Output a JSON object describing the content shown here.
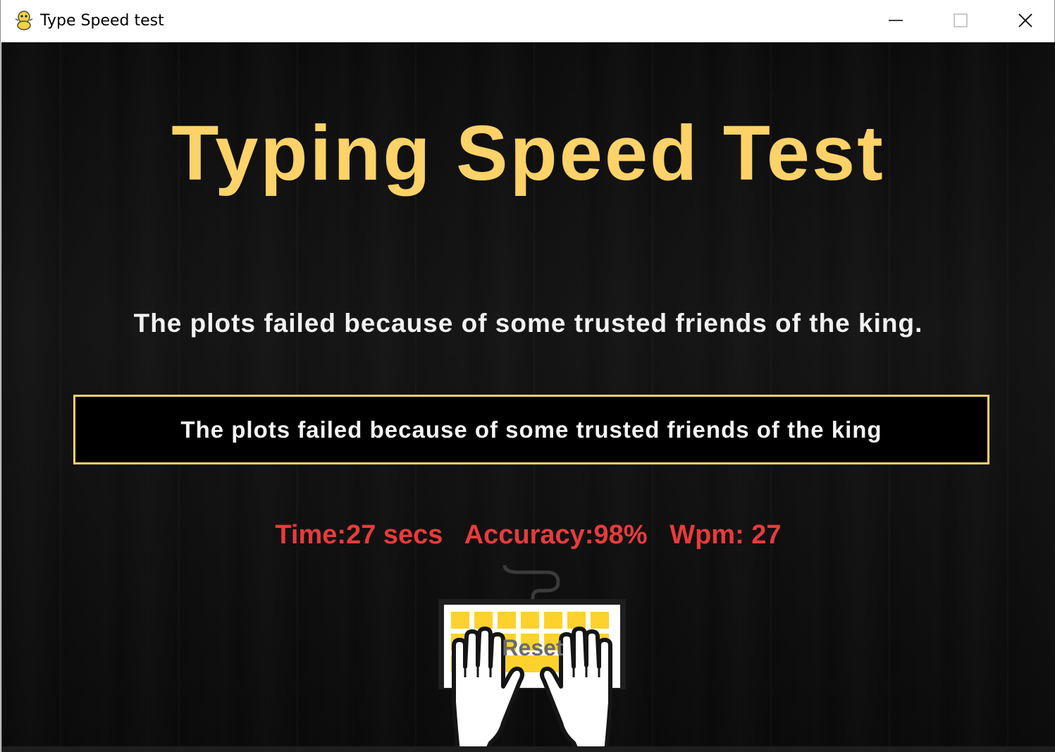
{
  "window": {
    "title": "Type Speed test",
    "app_icon": "pygame-snake-icon",
    "controls": {
      "minimize_icon": "minimize-icon",
      "maximize_icon": "maximize-icon",
      "close_icon": "close-icon"
    }
  },
  "app": {
    "heading": "Typing Speed Test",
    "prompt_sentence": "The plots failed because of some trusted friends of the king.",
    "input_text": "The plots failed because of some trusted friends of the king",
    "stats": {
      "time": "Time:27 secs",
      "accuracy": "Accuracy:98%",
      "wpm": "Wpm: 27"
    },
    "reset_button": {
      "label": "Reset",
      "icon": "keyboard-hands-icon"
    }
  },
  "colors": {
    "heading": "#fdd268",
    "prompt": "#f2f2f2",
    "input_border": "#fdd268",
    "stats": "#e83b3b",
    "background": "#0f0f0f",
    "key_yellow": "#fdd22c"
  }
}
